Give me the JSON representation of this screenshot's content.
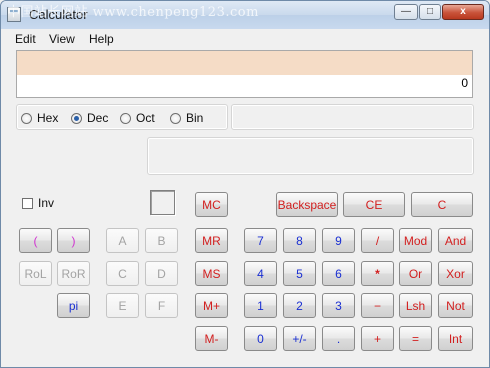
{
  "window": {
    "title": "Calculator",
    "watermark": "中国站长网站   www.chenpeng123.com",
    "minimize_glyph": "—",
    "maximize_glyph": "□",
    "close_glyph": "x"
  },
  "menu": [
    "Edit",
    "View",
    "Help"
  ],
  "display": {
    "value": "0",
    "memory_value": ""
  },
  "radix": {
    "options": [
      "Hex",
      "Dec",
      "Oct",
      "Bin"
    ],
    "selected": "Dec"
  },
  "inv_label": "Inv",
  "buttons": {
    "mc": "MC",
    "mr": "MR",
    "ms": "MS",
    "mplus": "M+",
    "mminus": "M-",
    "backspace": "Backspace",
    "ce": "CE",
    "c": "C",
    "lparen": "(",
    "rparen": ")",
    "a": "A",
    "b": "B",
    "rol": "RoL",
    "ror": "RoR",
    "cc": "C",
    "d": "D",
    "pi": "pi",
    "e": "E",
    "f": "F",
    "n7": "7",
    "n8": "8",
    "n9": "9",
    "div": "/",
    "mod": "Mod",
    "and": "And",
    "n4": "4",
    "n5": "5",
    "n6": "6",
    "mul": "*",
    "or": "Or",
    "xor": "Xor",
    "n1": "1",
    "n2": "2",
    "n3": "3",
    "sub": "−",
    "lsh": "Lsh",
    "not": "Not",
    "n0": "0",
    "sign": "+/-",
    "dot": ".",
    "add": "+",
    "eq": "=",
    "int": "Int"
  },
  "colors": {
    "red": "#d21f1f",
    "blue": "#1a2fd2",
    "pink": "#d032d0",
    "disabled": "#a3a3a3",
    "display_top": "#f5dcc6"
  }
}
